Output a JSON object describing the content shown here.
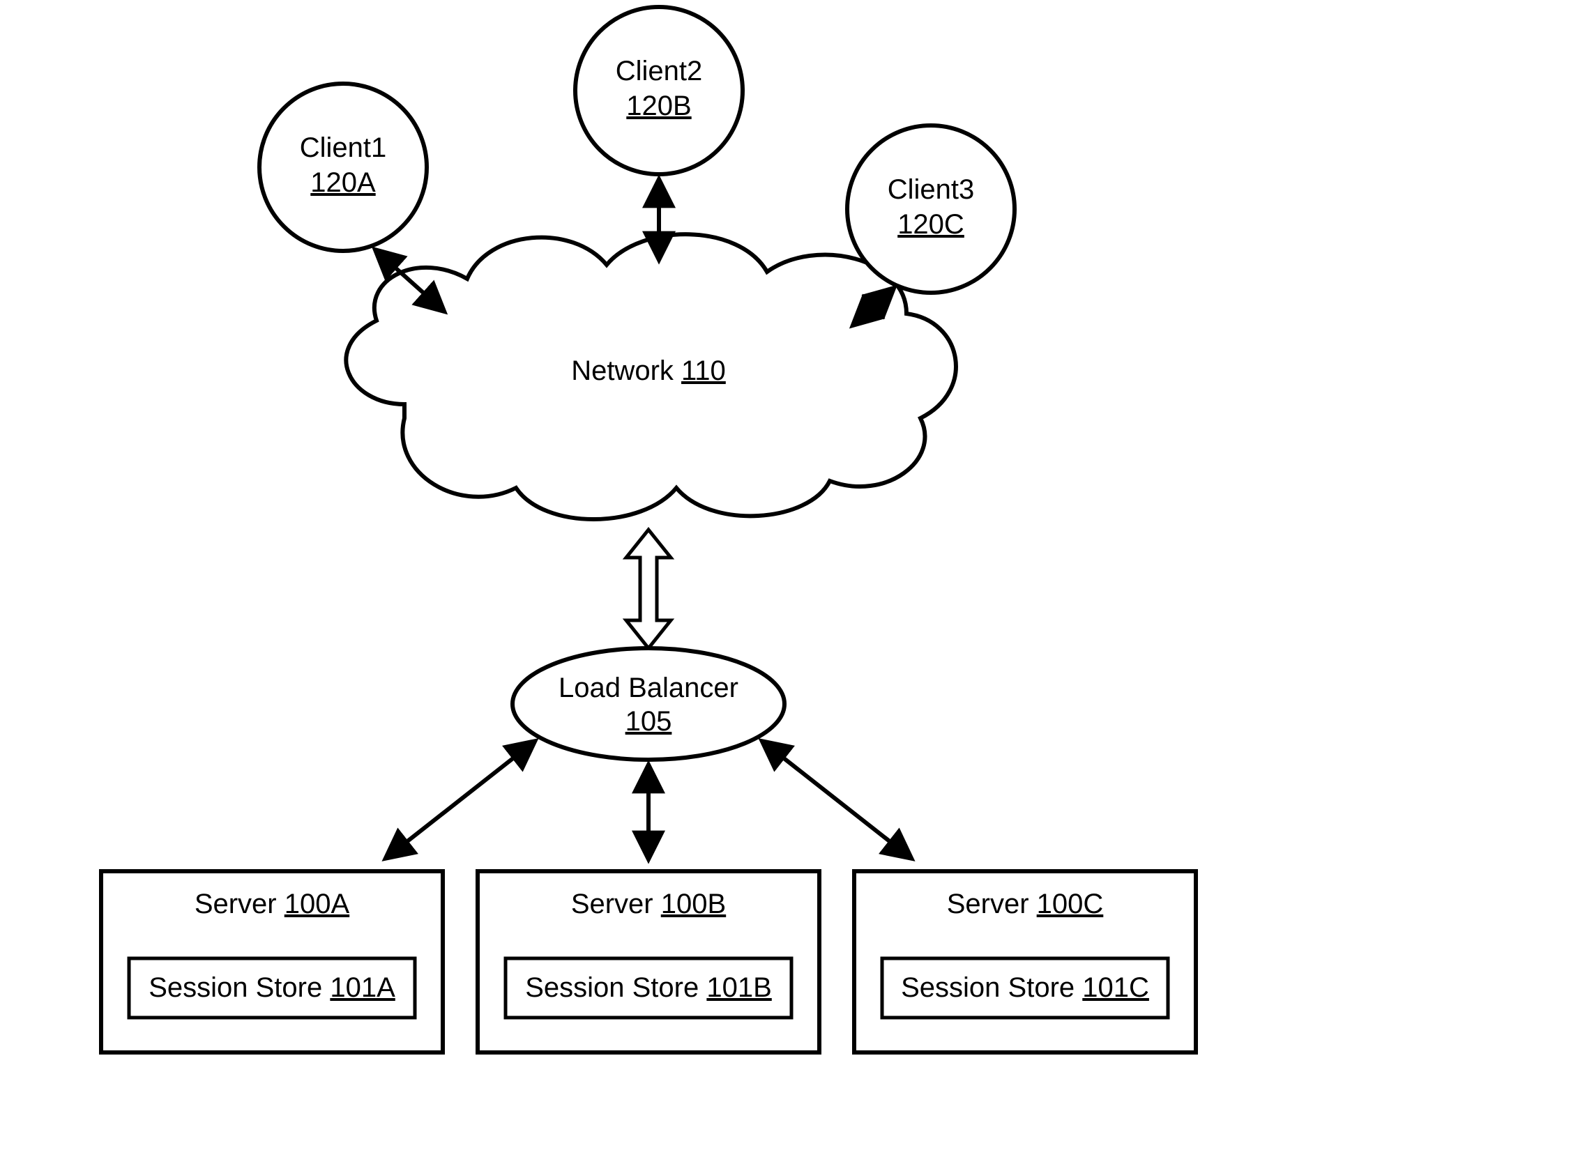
{
  "clients": [
    {
      "name": "Client1",
      "id": "120A"
    },
    {
      "name": "Client2",
      "id": "120B"
    },
    {
      "name": "Client3",
      "id": "120C"
    }
  ],
  "network": {
    "name": "Network",
    "id": "110"
  },
  "loadBalancer": {
    "name": "Load Balancer",
    "id": "105"
  },
  "servers": [
    {
      "name": "Server",
      "id": "100A",
      "store": {
        "name": "Session Store",
        "id": "101A"
      }
    },
    {
      "name": "Server",
      "id": "100B",
      "store": {
        "name": "Session Store",
        "id": "101B"
      }
    },
    {
      "name": "Server",
      "id": "100C",
      "store": {
        "name": "Session Store",
        "id": "101C"
      }
    }
  ]
}
